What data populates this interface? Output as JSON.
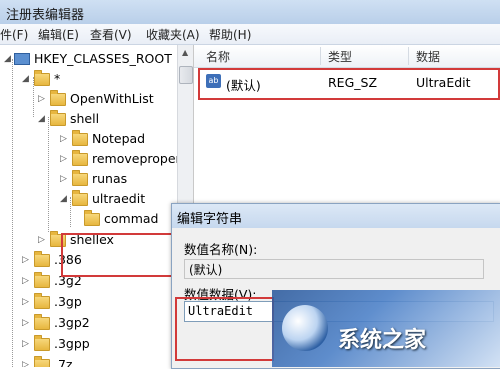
{
  "window": {
    "title": "注册表编辑器"
  },
  "menu": [
    "件(F)",
    "编辑(E)",
    "查看(V)",
    "收藏夹(A)",
    "帮助(H)"
  ],
  "tree": {
    "root": "HKEY_CLASSES_ROOT",
    "star": "*",
    "openwithlist": "OpenWithList",
    "shell": "shell",
    "notepad": "Notepad",
    "removeproperties": "removeproper",
    "runas": "runas",
    "ultraedit": "ultraedit",
    "commad": "commad",
    "shellex": "shellex",
    "ext": [
      ".386",
      ".3g2",
      ".3gp",
      ".3gp2",
      ".3gpp",
      ".7z"
    ]
  },
  "list": {
    "headers": {
      "name": "名称",
      "type": "类型",
      "data": "数据"
    },
    "row": {
      "icon": "ab",
      "name": "(默认)",
      "type": "REG_SZ",
      "data": "UltraEdit"
    }
  },
  "dialog": {
    "title": "编辑字符串",
    "name_label": "数值名称(N):",
    "name_value": "(默认)",
    "data_label": "数值数据(V):",
    "data_value": "UltraEdit"
  },
  "watermark": {
    "text": "系统之家"
  }
}
